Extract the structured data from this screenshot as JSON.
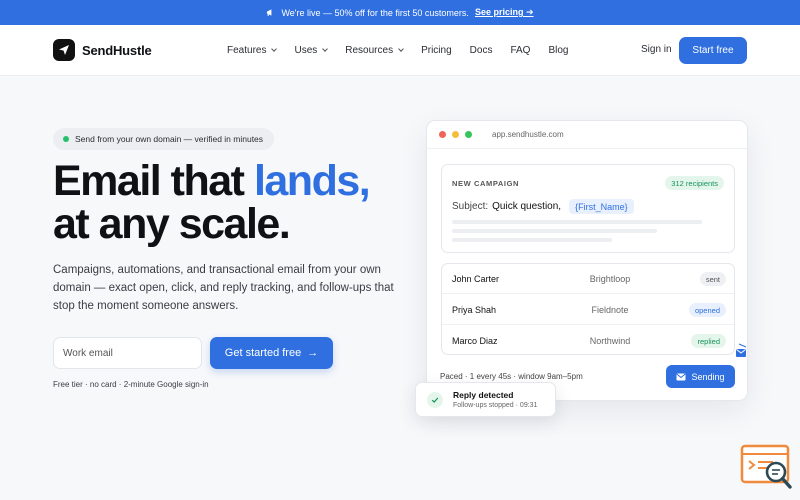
{
  "announcement": {
    "icon": "megaphone-icon",
    "text": "We're live — 50% off for the first 50 customers.",
    "link": "See pricing",
    "arrow": "➔"
  },
  "nav": {
    "brand": "SendHustle",
    "links": [
      {
        "label": "Features",
        "dropdown": true
      },
      {
        "label": "Uses",
        "dropdown": true
      },
      {
        "label": "Resources",
        "dropdown": true
      },
      {
        "label": "Pricing",
        "dropdown": false
      },
      {
        "label": "Docs",
        "dropdown": false
      },
      {
        "label": "FAQ",
        "dropdown": false
      },
      {
        "label": "Blog",
        "dropdown": false
      }
    ],
    "signin": "Sign in",
    "cta": "Start free"
  },
  "hero": {
    "pill": "Send from your own domain — verified in minutes",
    "headline_1a": "Email that ",
    "headline_1b": "lands,",
    "headline_2": "at any scale.",
    "subtext": "Campaigns, automations, and transactional email from your own domain — exact open, click, and reply tracking, and follow-ups that stop the moment someone answers.",
    "email_placeholder": "Work email",
    "cta": "Get started free",
    "cta_arrow": "→",
    "fine_print": "Free tier · no card · 2-minute Google sign-in"
  },
  "mockup": {
    "url": "app.sendhustle.com",
    "campaign_label": "NEW CAMPAIGN",
    "recipients": "312 recipients",
    "subject_label": "Subject:",
    "subject_value": "Quick question,",
    "subject_token": "{First_Name}",
    "rows": [
      {
        "name": "John Carter",
        "company": "Brightloop",
        "status": "sent",
        "fg": "#555555",
        "bg": "#eef0f3"
      },
      {
        "name": "Priya Shah",
        "company": "Fieldnote",
        "status": "opened",
        "fg": "#2f6fe0",
        "bg": "#e8f0fd"
      },
      {
        "name": "Marco Diaz",
        "company": "Northwind",
        "status": "replied",
        "fg": "#17935a",
        "bg": "#e4f6ec"
      }
    ],
    "paced": "Paced · 1 every 45s · window 9am–5pm",
    "sending": "Sending"
  },
  "toast": {
    "title": "Reply detected",
    "subtitle": "Follow-ups stopped · 09:31"
  },
  "colors": {
    "accent": "#2f6fe0",
    "success": "#22c06b",
    "text": "#0f1115"
  }
}
